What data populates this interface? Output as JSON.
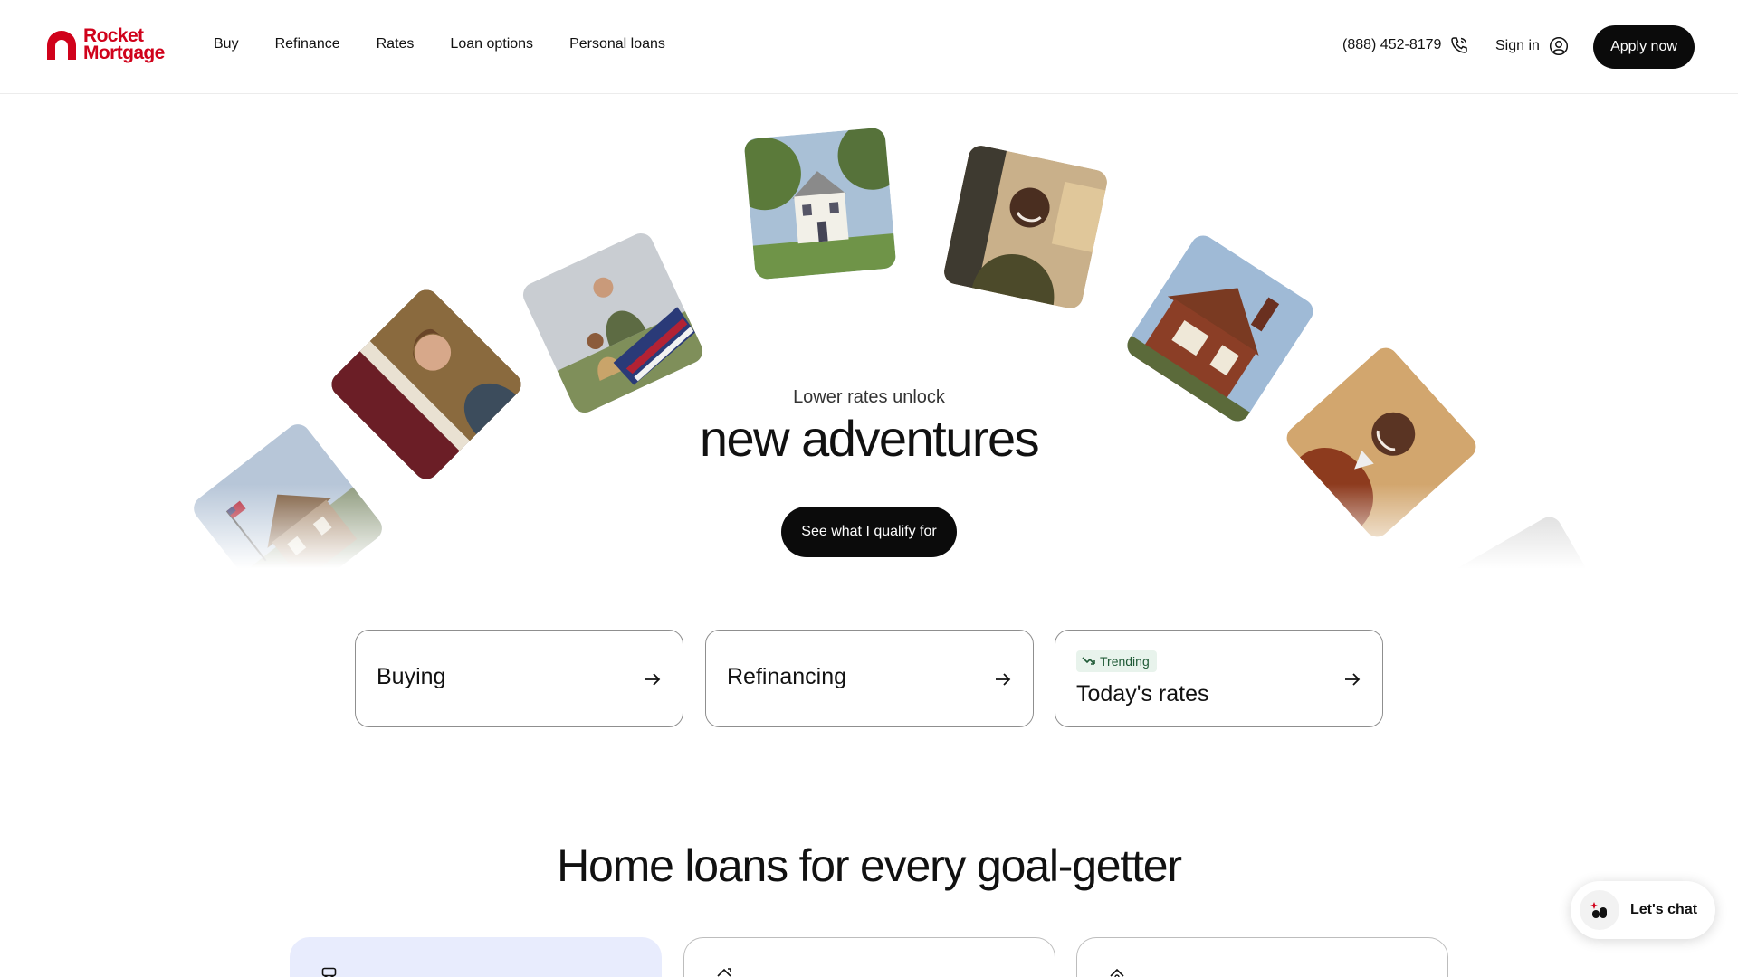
{
  "brand": {
    "line1": "Rocket",
    "line2": "Mortgage",
    "color": "#d0021b"
  },
  "nav": {
    "items": [
      "Buy",
      "Refinance",
      "Rates",
      "Loan options",
      "Personal loans"
    ],
    "phone": "(888) 452-8179",
    "signin": "Sign in",
    "apply": "Apply now"
  },
  "hero": {
    "subtitle": "Lower rates unlock",
    "title": "new adventures",
    "cta": "See what I qualify for",
    "photos": [
      "house-with-flag",
      "woman-at-door",
      "couple-with-flag",
      "white-farmhouse",
      "smiling-man-kitchen",
      "brick-house",
      "smiling-older-man",
      "partial-photo"
    ]
  },
  "quick_links": [
    {
      "label": "Buying",
      "badge": ""
    },
    {
      "label": "Refinancing",
      "badge": ""
    },
    {
      "label": "Today's rates",
      "badge": "Trending"
    }
  ],
  "section": {
    "title": "Home loans for every goal-getter"
  },
  "loan_cards": [
    {
      "icon": "van-icon"
    },
    {
      "icon": "house-refresh-icon"
    },
    {
      "icon": "house-dollar-icon"
    }
  ],
  "chat": {
    "label": "Let's chat"
  },
  "colors": {
    "accent": "#d0021b",
    "button": "#0b0b0b",
    "badge_bg": "#e8f3ec",
    "active_card": "#e8ecfd"
  }
}
